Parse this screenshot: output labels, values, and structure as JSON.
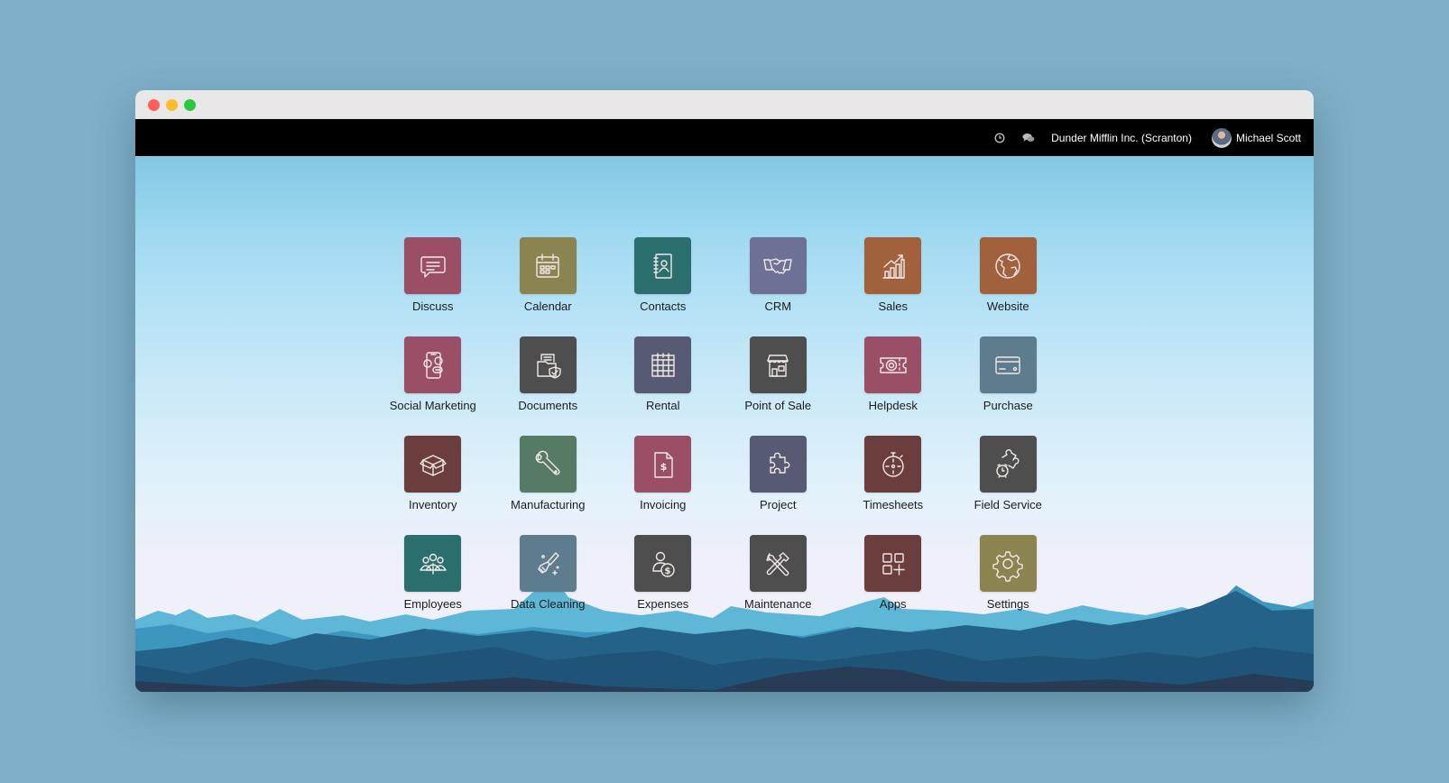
{
  "window": {
    "traffic_lights": [
      "close",
      "minimize",
      "maximize"
    ]
  },
  "navbar": {
    "activity_icon": "clock-icon",
    "messages_icon": "chat-icon",
    "company": "Dunder Mifflin Inc. (Scranton)",
    "user_name": "Michael Scott"
  },
  "apps": [
    {
      "label": "Discuss",
      "icon": "chat-bubble-icon",
      "color": "#9b4f66"
    },
    {
      "label": "Calendar",
      "icon": "calendar-icon",
      "color": "#8c8450"
    },
    {
      "label": "Contacts",
      "icon": "address-book-icon",
      "color": "#2b6e6e"
    },
    {
      "label": "CRM",
      "icon": "handshake-icon",
      "color": "#6e7196"
    },
    {
      "label": "Sales",
      "icon": "growth-chart-icon",
      "color": "#a2613d"
    },
    {
      "label": "Website",
      "icon": "globe-icon",
      "color": "#a2613d"
    },
    {
      "label": "Social Marketing",
      "icon": "phone-social-icon",
      "color": "#9b4f66"
    },
    {
      "label": "Documents",
      "icon": "folder-shield-icon",
      "color": "#4e4e4e"
    },
    {
      "label": "Rental",
      "icon": "rental-calendar-icon",
      "color": "#575a73"
    },
    {
      "label": "Point of Sale",
      "icon": "storefront-icon",
      "color": "#4e4e4e"
    },
    {
      "label": "Helpdesk",
      "icon": "lifebuoy-ticket-icon",
      "color": "#9b4f66"
    },
    {
      "label": "Purchase",
      "icon": "credit-card-icon",
      "color": "#5d7d8f"
    },
    {
      "label": "Inventory",
      "icon": "box-icon",
      "color": "#6b3d3d"
    },
    {
      "label": "Manufacturing",
      "icon": "wrench-icon",
      "color": "#567a63"
    },
    {
      "label": "Invoicing",
      "icon": "invoice-dollar-icon",
      "color": "#9b4f66"
    },
    {
      "label": "Project",
      "icon": "puzzle-piece-icon",
      "color": "#575a73"
    },
    {
      "label": "Timesheets",
      "icon": "stopwatch-icon",
      "color": "#6b3d3d"
    },
    {
      "label": "Field Service",
      "icon": "puzzle-clock-icon",
      "color": "#4e4e4e"
    },
    {
      "label": "Employees",
      "icon": "people-group-icon",
      "color": "#2b6e6e"
    },
    {
      "label": "Data Cleaning",
      "icon": "brush-sparkle-icon",
      "color": "#5d7d8f"
    },
    {
      "label": "Expenses",
      "icon": "person-dollar-icon",
      "color": "#4e4e4e"
    },
    {
      "label": "Maintenance",
      "icon": "hammer-wrench-icon",
      "color": "#4e4e4e"
    },
    {
      "label": "Apps",
      "icon": "apps-grid-plus-icon",
      "color": "#6b3d3d"
    },
    {
      "label": "Settings",
      "icon": "gear-icon",
      "color": "#8c8450"
    }
  ]
}
